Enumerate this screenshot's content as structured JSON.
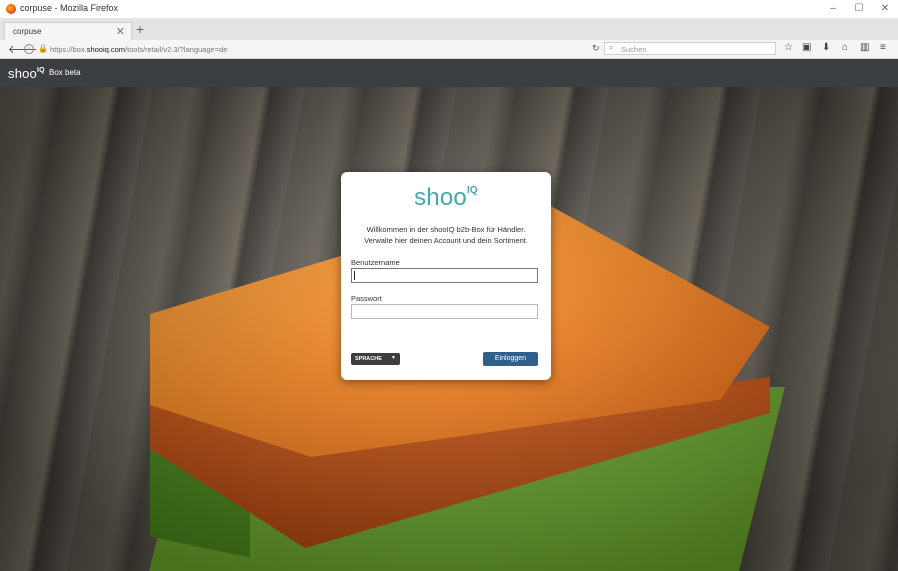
{
  "window": {
    "title": "corpuse - Mozilla Firefox",
    "buttons": {
      "minimize": "–",
      "maximize": "☐",
      "close": "✕"
    }
  },
  "tabs": [
    {
      "label": "corpuse",
      "close": "✕"
    }
  ],
  "new_tab": "+",
  "navbar": {
    "url_prefix": "https://box.",
    "url_domain": "shooiq.com",
    "url_path": "/tools/retail/v2.3/?language=de",
    "search_placeholder": "Suchen"
  },
  "app": {
    "logo_text": "shoo",
    "logo_sup": "IQ",
    "subtitle": "Box beta"
  },
  "login": {
    "logo_text": "shoo",
    "logo_sup": "IQ",
    "welcome_line1": "Willkommen in der shooIQ b2b-Box für Händler.",
    "welcome_line2": "Verwalte hier deinen Account und dein Sortiment.",
    "username_label": "Benutzername",
    "username_value": "",
    "password_label": "Passwort",
    "password_value": "",
    "language_button": "SPRACHE",
    "submit_button": "Einloggen"
  },
  "colors": {
    "accent_teal": "#47a6b0",
    "header_dark": "#3b3f42",
    "login_button": "#2f5f8a"
  },
  "icons": [
    "firefox-icon",
    "back-icon",
    "info-icon",
    "lock-icon",
    "reload-icon",
    "search-icon",
    "bookmark-star-icon",
    "library-icon",
    "download-icon",
    "home-icon",
    "sidebar-icon",
    "menu-icon"
  ]
}
